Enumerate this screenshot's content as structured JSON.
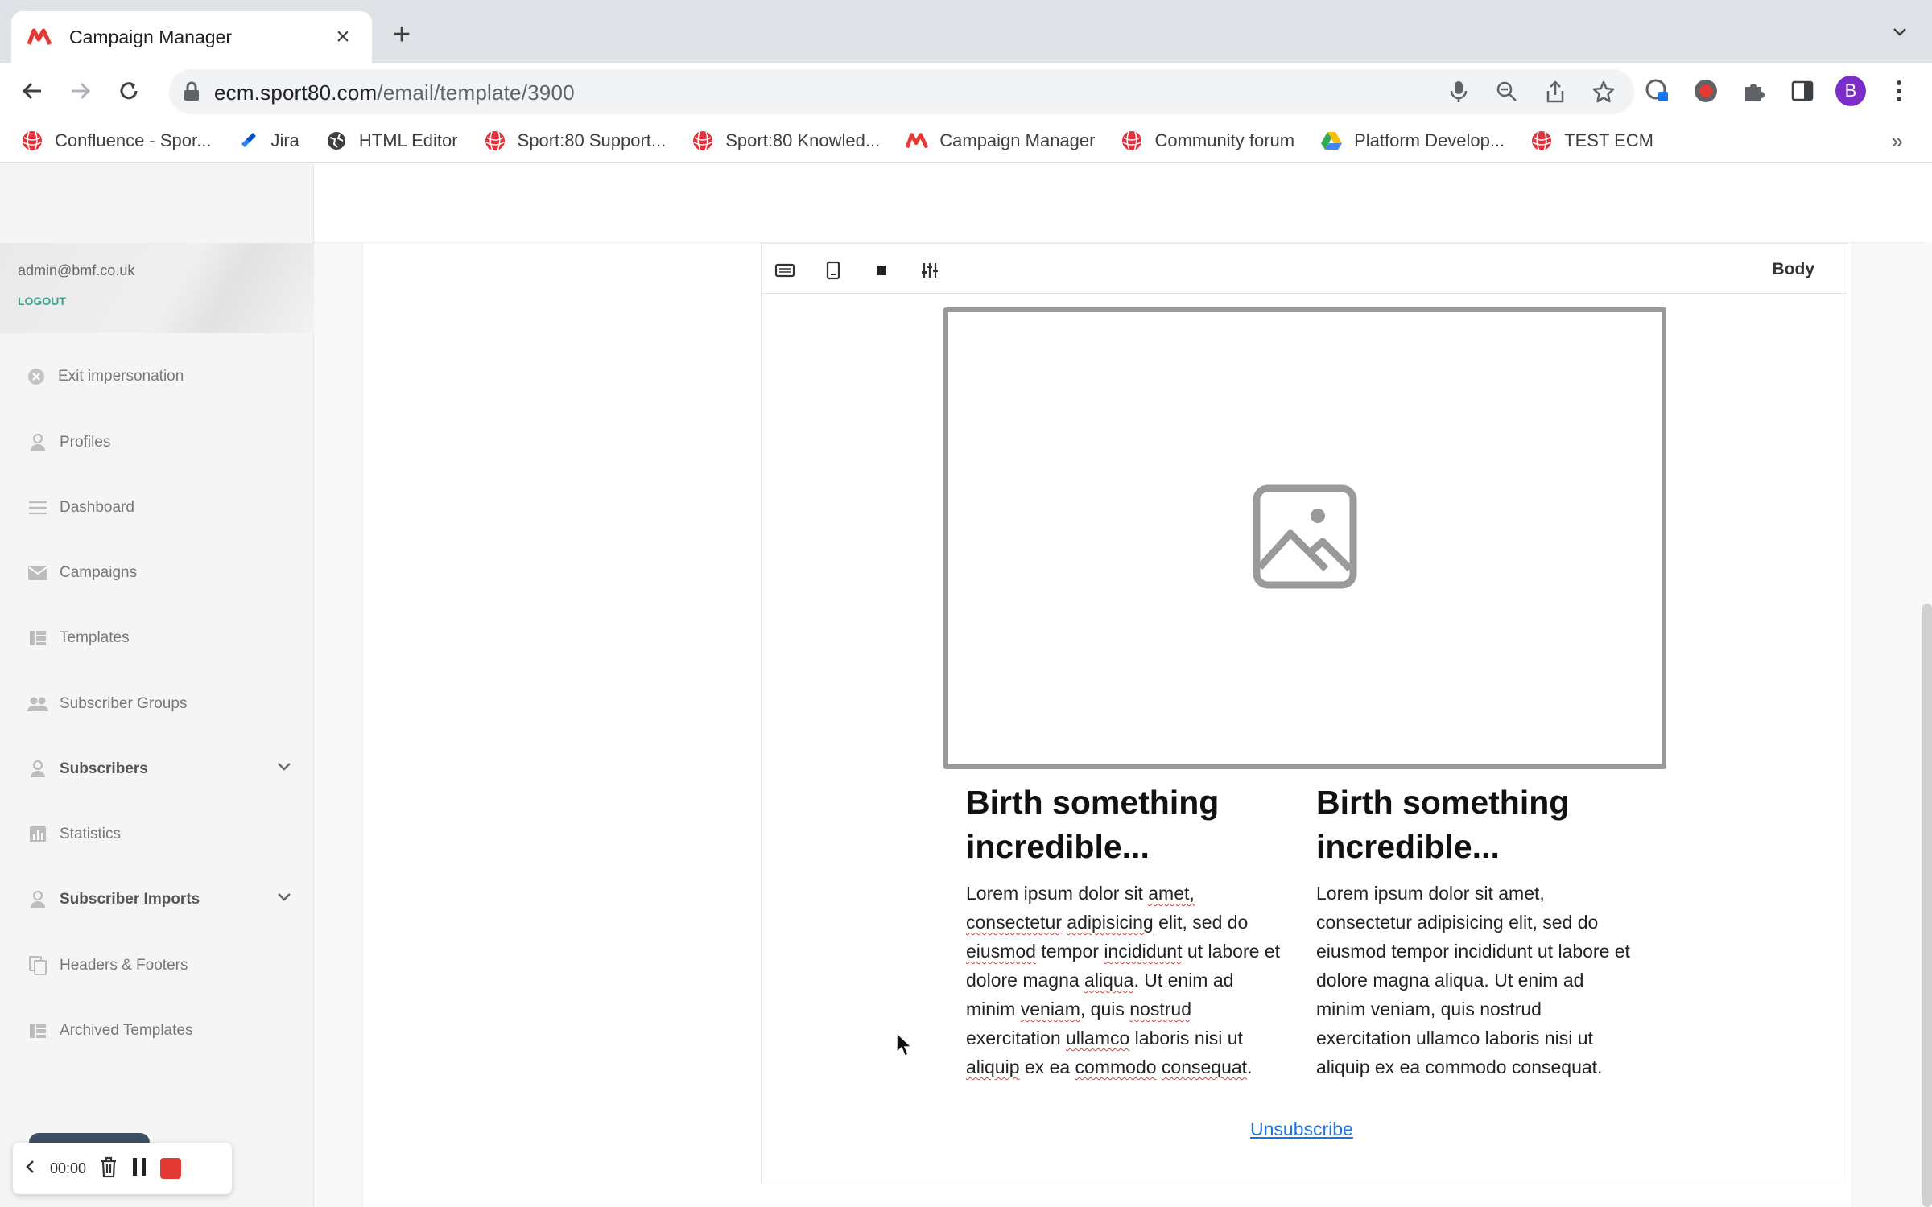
{
  "browser": {
    "tab_title": "Campaign Manager",
    "tab_close": "×",
    "new_tab": "+",
    "url_domain": "ecm.sport80.com",
    "url_path": "/email/template/3900",
    "profile_initial": "B",
    "bookmarks_more": "»",
    "bookmarks": [
      {
        "label": "Confluence - Spor...",
        "icon": "sport80-globe-icon"
      },
      {
        "label": "Jira",
        "icon": "jira-icon"
      },
      {
        "label": "HTML Editor",
        "icon": "globe-icon"
      },
      {
        "label": "Sport:80 Support...",
        "icon": "sport80-globe-icon"
      },
      {
        "label": "Sport:80 Knowled...",
        "icon": "sport80-globe-icon"
      },
      {
        "label": "Campaign Manager",
        "icon": "campaign-manager-logo-icon"
      },
      {
        "label": "Community forum",
        "icon": "sport80-globe-icon"
      },
      {
        "label": "Platform Develop...",
        "icon": "google-drive-icon"
      },
      {
        "label": "TEST ECM",
        "icon": "sport80-globe-icon"
      }
    ]
  },
  "sidebar": {
    "email": "admin@bmf.co.uk",
    "logout": "LOGOUT",
    "items": [
      {
        "label": "Exit impersonation",
        "icon": "close-circle-icon"
      },
      {
        "label": "Profiles",
        "icon": "person-icon"
      },
      {
        "label": "Dashboard",
        "icon": "menu-lines-icon"
      },
      {
        "label": "Campaigns",
        "icon": "envelope-icon"
      },
      {
        "label": "Templates",
        "icon": "grid-icon"
      },
      {
        "label": "Subscriber Groups",
        "icon": "group-icon"
      },
      {
        "label": "Subscribers",
        "icon": "person-icon"
      },
      {
        "label": "Statistics",
        "icon": "bar-chart-icon"
      },
      {
        "label": "Subscriber Imports",
        "icon": "person-icon"
      },
      {
        "label": "Headers & Footers",
        "icon": "copy-icon"
      },
      {
        "label": "Archived Templates",
        "icon": "grid-icon"
      }
    ]
  },
  "recorder": {
    "time": "00:00"
  },
  "editor": {
    "toolbar_label": "Body",
    "column_left": {
      "heading": "Birth something incredible...",
      "body": [
        "Lorem ipsum dolor sit ",
        "amet,",
        " ",
        "consectetur",
        " ",
        "adipisicing",
        " elit, sed do ",
        "eiusmod",
        " tempor ",
        "incididunt",
        " ut labore et dolore magna ",
        "aliqua",
        ". Ut enim ad minim ",
        "veniam",
        ", quis ",
        "nostrud",
        " exercitation ",
        "ullamco",
        " laboris nisi ut ",
        "aliquip",
        " ex ea ",
        "commodo",
        " ",
        "consequat",
        "."
      ]
    },
    "column_right": {
      "heading": "Birth something incredible...",
      "body": "Lorem ipsum dolor sit amet, consectetur adipisicing elit, sed do eiusmod tempor incididunt ut labore et dolore magna aliqua. Ut enim ad minim veniam, quis nostrud exercitation ullamco laboris nisi ut aliquip ex ea commodo consequat."
    },
    "unsubscribe": "Unsubscribe"
  },
  "colors": {
    "accent_logout": "#3aa38a",
    "link": "#1a73e8",
    "record_red": "#e53935",
    "profile": "#7b2ec7"
  }
}
